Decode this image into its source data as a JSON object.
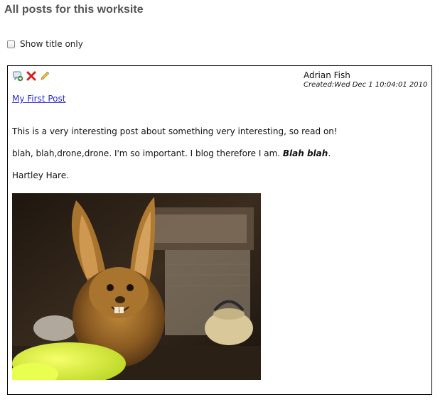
{
  "page": {
    "title": "All posts for this worksite"
  },
  "options": {
    "show_title_only_label": "Show title only",
    "show_title_only_checked": false
  },
  "post": {
    "toolbar": {
      "comment_icon": "add-comment-icon",
      "delete_icon": "delete-icon",
      "edit_icon": "edit-pencil-icon"
    },
    "author": "Adrian Fish",
    "created": "Created:Wed Dec 1 10:04:01 2010",
    "title_link": "My First Post",
    "paragraphs": {
      "p1": "This is a very interesting post about something very interesting, so read on!",
      "p2_plain": "blah, blah,drone,drone. I'm so important. I blog therefore I am. ",
      "p2_bold_italic": "Blah blah",
      "p2_end": ".",
      "p3": "Hartley Hare."
    },
    "image_subject": "hare-puppet-photo"
  }
}
